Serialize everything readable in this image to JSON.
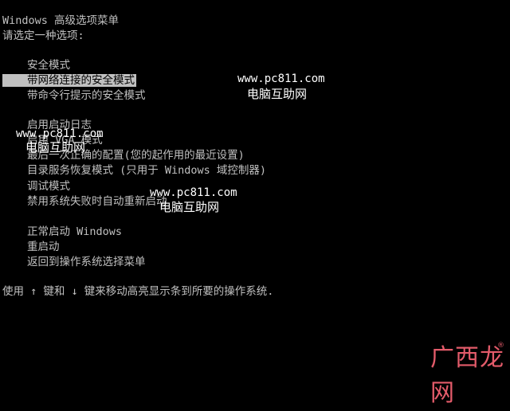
{
  "header": {
    "title": "Windows 高级选项菜单",
    "prompt": "请选定一种选项:"
  },
  "menu": {
    "group1": [
      "安全模式",
      "带网络连接的安全模式",
      "带命令行提示的安全模式"
    ],
    "group2": [
      "启用启动日志",
      "启用 VGA 模式",
      "最后一次正确的配置(您的起作用的最近设置)",
      "目录服务恢复模式 (只用于 Windows 域控制器)",
      "调试模式",
      "禁用系统失败时自动重新启动"
    ],
    "group3": [
      "正常启动 Windows",
      "重启动",
      "返回到操作系统选择菜单"
    ],
    "selected": "带网络连接的安全模式"
  },
  "footer": {
    "text": "使用 ↑ 键和 ↓ 键来移动高亮显示条到所要的操作系统."
  },
  "watermarks": {
    "url": "www.pc811.com",
    "name": "电脑互助网"
  },
  "logo": {
    "text": "广西龙网",
    "mark": "®"
  },
  "colors": {
    "background": "#000000",
    "text": "#c0c0c0",
    "highlight_bg": "#c0c0c0",
    "highlight_text": "#000000",
    "logo": "#e35b6a"
  }
}
